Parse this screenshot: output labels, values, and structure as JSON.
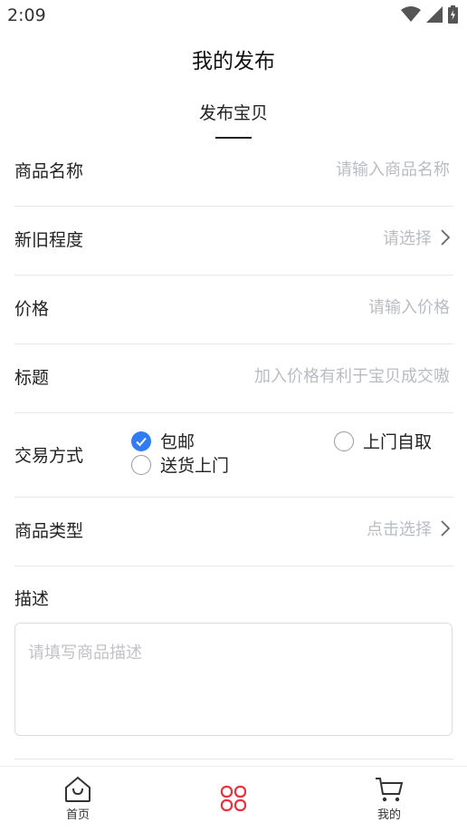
{
  "status_bar": {
    "time": "2:09"
  },
  "header": {
    "title": "我的发布"
  },
  "sub_tab": {
    "label": "发布宝贝"
  },
  "form": {
    "product_name": {
      "label": "商品名称",
      "placeholder": "请输入商品名称"
    },
    "condition": {
      "label": "新旧程度",
      "value": "请选择"
    },
    "price": {
      "label": "价格",
      "placeholder": "请输入价格"
    },
    "title": {
      "label": "标题",
      "placeholder": "加入价格有利于宝贝成交嗷"
    },
    "trade_method": {
      "label": "交易方式",
      "options": [
        {
          "label": "包邮",
          "checked": true
        },
        {
          "label": "上门自取",
          "checked": false
        },
        {
          "label": "送货上门",
          "checked": false
        }
      ]
    },
    "product_type": {
      "label": "商品类型",
      "value": "点击选择"
    },
    "description": {
      "label": "描述",
      "placeholder": "请填写商品描述"
    }
  },
  "tab_bar": {
    "items": [
      {
        "label": "首页",
        "icon": "home-icon"
      },
      {
        "label": "",
        "icon": "grid-icon",
        "active": true
      },
      {
        "label": "我的",
        "icon": "cart-icon"
      }
    ]
  },
  "colors": {
    "accent": "#2f7cf6",
    "active_tab": "#e8333c",
    "placeholder": "#b9bcc2"
  }
}
